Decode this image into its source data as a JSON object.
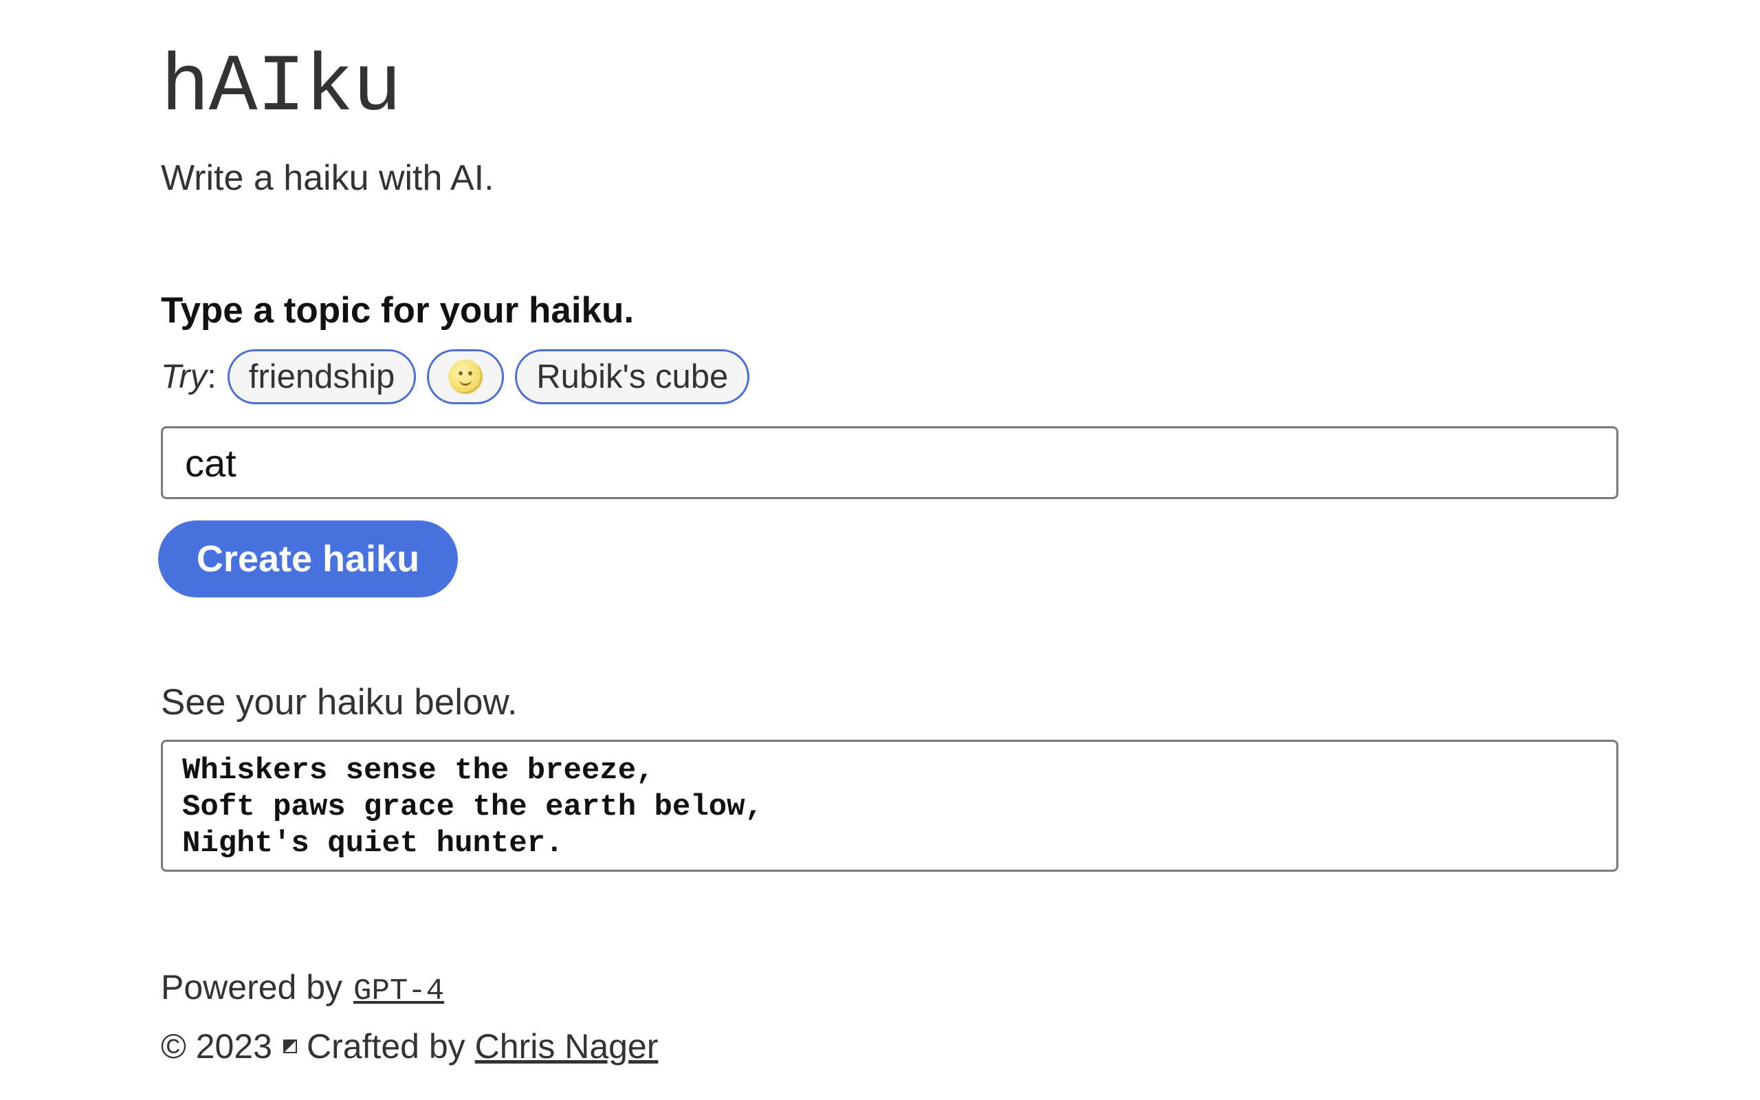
{
  "header": {
    "title": "hAIku",
    "subtitle": "Write a haiku with AI."
  },
  "form": {
    "topic_heading": "Type a topic for your haiku.",
    "try_label": "Try",
    "try_colon": ":",
    "suggestions": [
      {
        "label": "friendship"
      },
      {
        "label": "",
        "icon": "moon-face-emoji-icon"
      },
      {
        "label": "Rubik's cube"
      }
    ],
    "topic_value": "cat",
    "submit_label": "Create haiku"
  },
  "output": {
    "label": "See your haiku below.",
    "haiku": "Whiskers sense the breeze,\nSoft paws grace the earth below,\nNight's quiet hunter."
  },
  "footer": {
    "powered_by_text": "Powered by",
    "model_link": "GPT-4",
    "copyright": "© 2023",
    "crafted_by_text": "Crafted by",
    "author_link": "Chris Nager"
  },
  "colors": {
    "accent": "#4872e0",
    "chip_border": "#4a6fd8",
    "text": "#333333"
  }
}
